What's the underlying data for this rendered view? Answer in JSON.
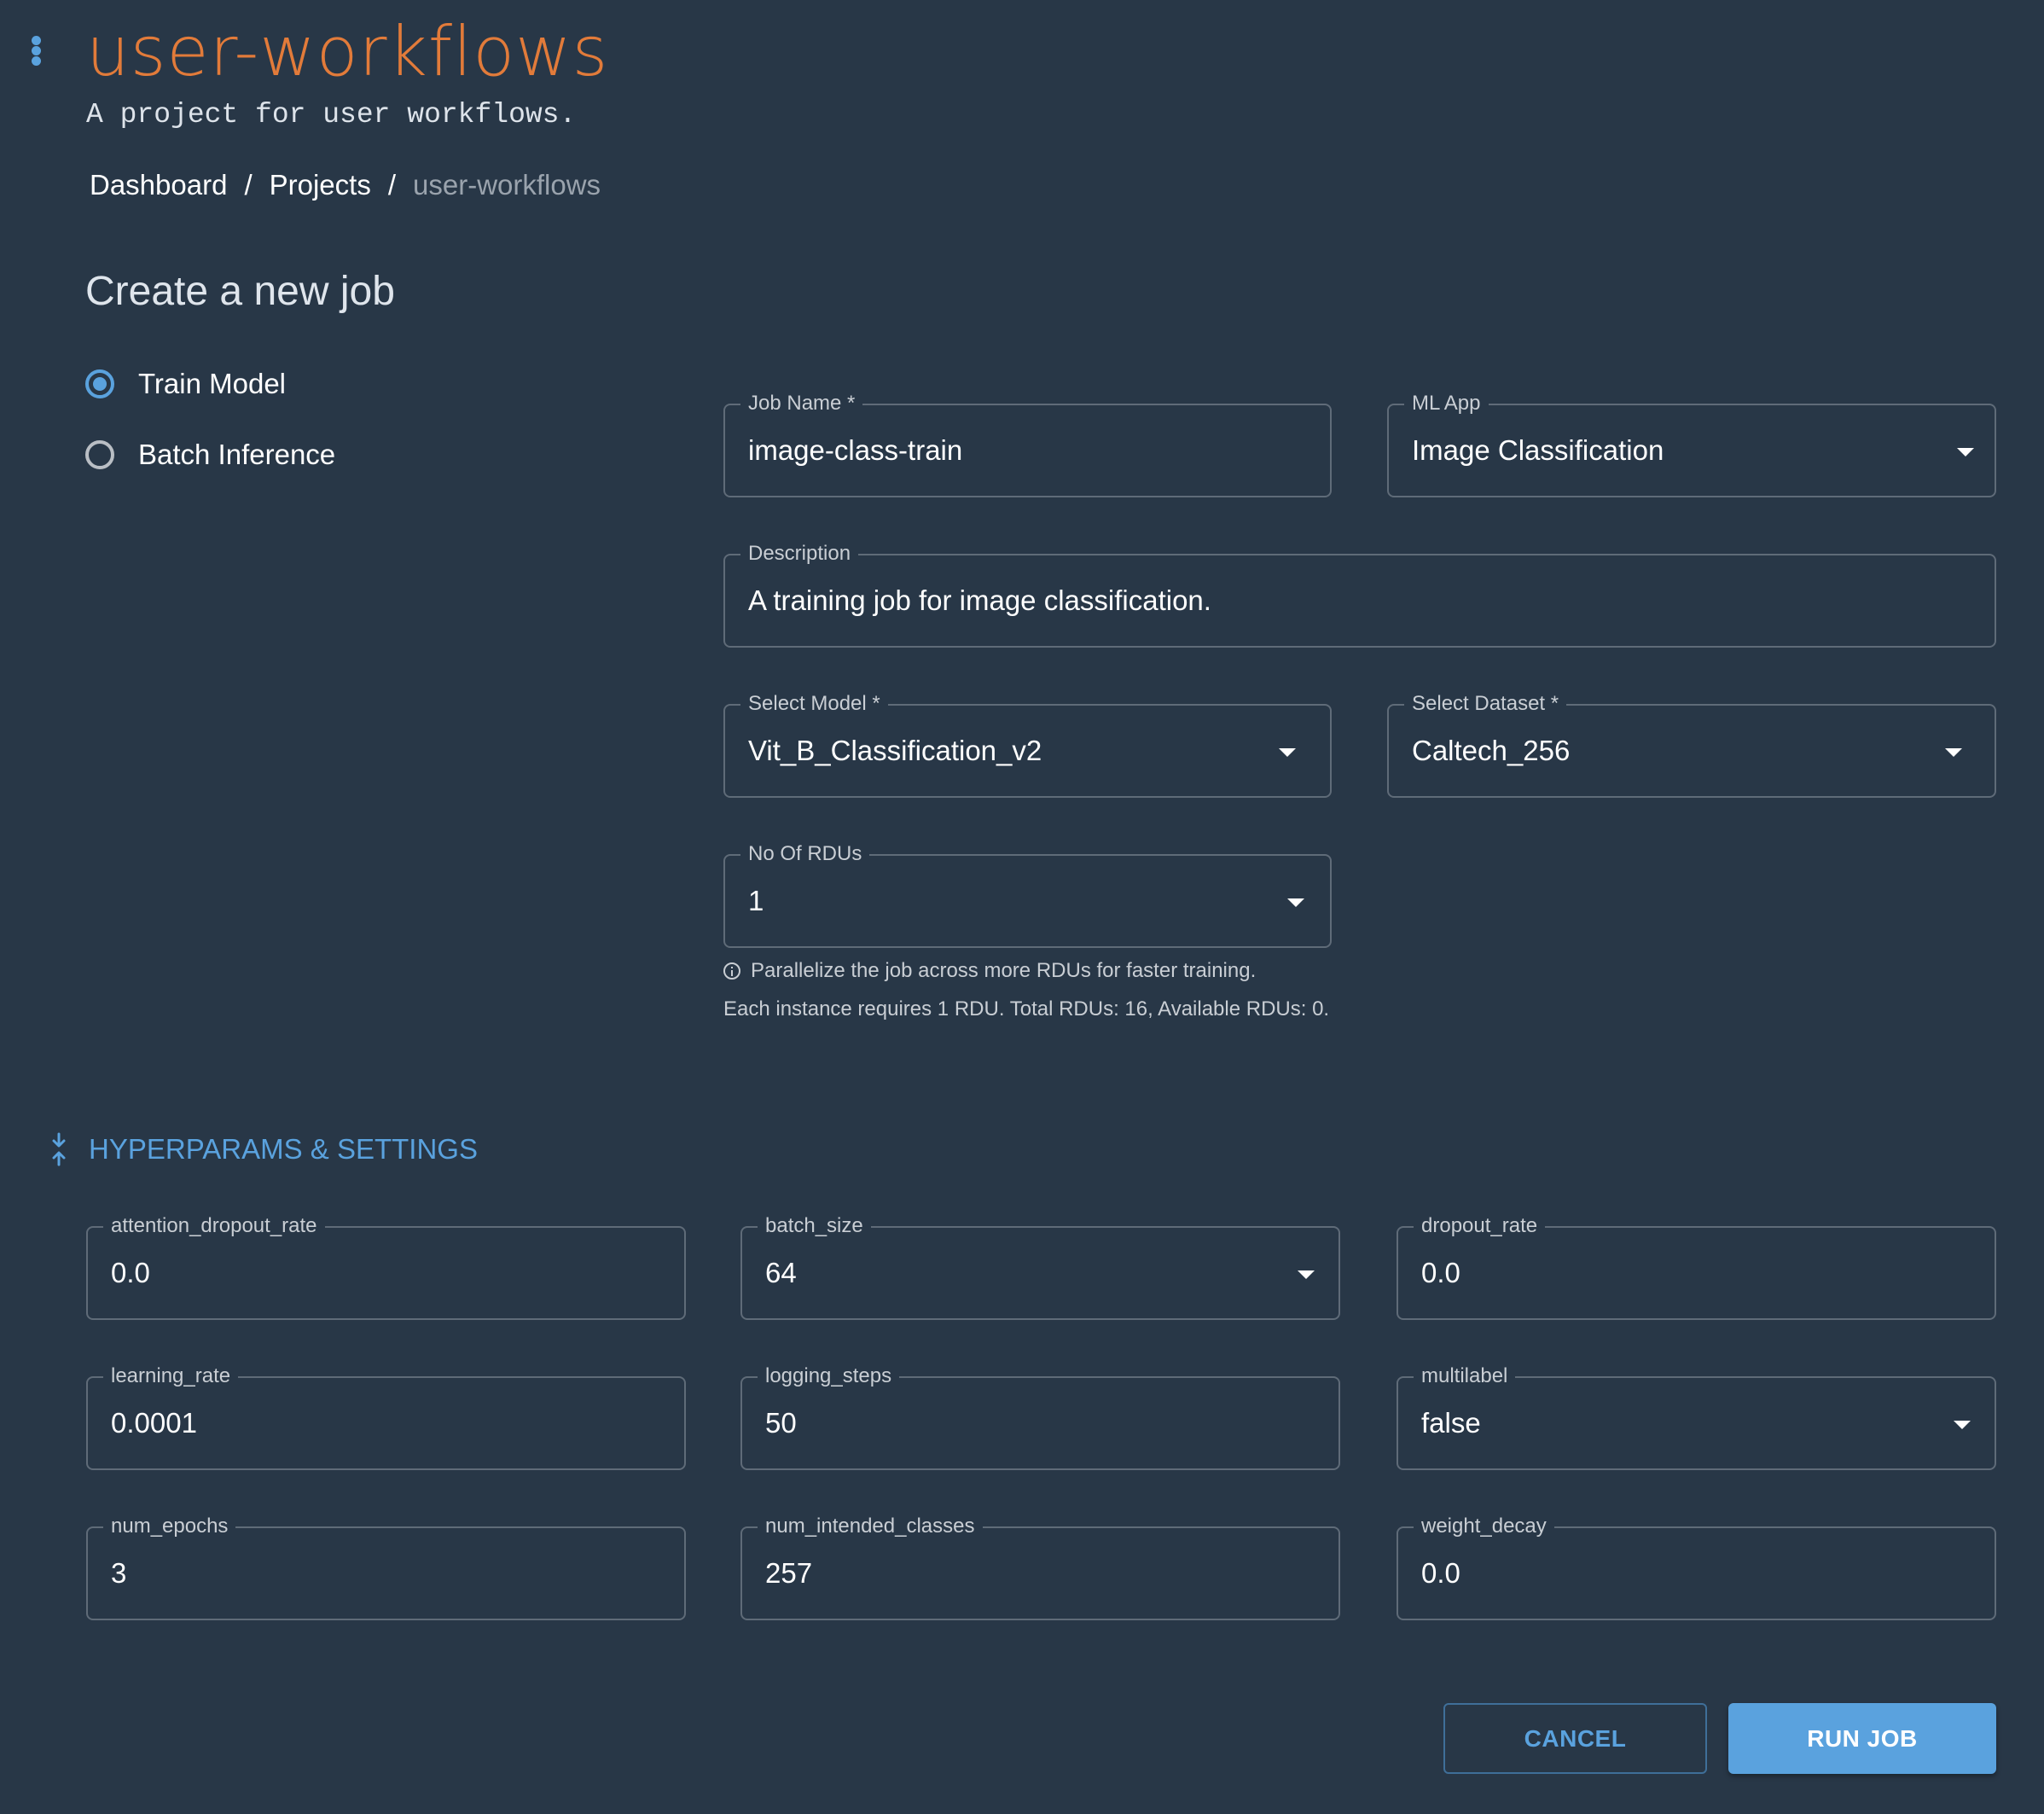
{
  "header": {
    "menu_icon": "kebab-vertical-icon",
    "title": "user-workflows",
    "subtitle": "A project for user workflows.",
    "title_color": "#e27b3a"
  },
  "breadcrumb": {
    "items": [
      "Dashboard",
      "Projects"
    ],
    "current": "user-workflows",
    "separator": "/"
  },
  "page": {
    "title": "Create a new job"
  },
  "job_type": {
    "options": [
      {
        "label": "Train Model",
        "selected": true
      },
      {
        "label": "Batch Inference",
        "selected": false
      }
    ]
  },
  "form": {
    "job_name": {
      "label": "Job Name *",
      "value": "image-class-train"
    },
    "ml_app": {
      "label": "ML App",
      "value": "Image Classification"
    },
    "description": {
      "label": "Description",
      "value": "A training job for image classification."
    },
    "model": {
      "label": "Select Model *",
      "value": "Vit_B_Classification_v2"
    },
    "dataset": {
      "label": "Select Dataset *",
      "value": "Caltech_256"
    },
    "rdus": {
      "label": "No Of RDUs",
      "value": "1",
      "info": "Parallelize the job across more RDUs for faster training.",
      "detail": "Each instance requires 1 RDU. Total RDUs: 16, Available RDUs: 0."
    }
  },
  "hyperparams": {
    "section_title": "HYPERPARAMS & SETTINGS",
    "section_icon": "collapse-vertical-icon",
    "fields": [
      {
        "label": "attention_dropout_rate",
        "value": "0.0",
        "type": "text"
      },
      {
        "label": "batch_size",
        "value": "64",
        "type": "select"
      },
      {
        "label": "dropout_rate",
        "value": "0.0",
        "type": "text"
      },
      {
        "label": "learning_rate",
        "value": "0.0001",
        "type": "text"
      },
      {
        "label": "logging_steps",
        "value": "50",
        "type": "text"
      },
      {
        "label": "multilabel",
        "value": "false",
        "type": "select"
      },
      {
        "label": "num_epochs",
        "value": "3",
        "type": "text"
      },
      {
        "label": "num_intended_classes",
        "value": "257",
        "type": "text"
      },
      {
        "label": "weight_decay",
        "value": "0.0",
        "type": "text"
      }
    ]
  },
  "actions": {
    "cancel_label": "CANCEL",
    "run_label": "RUN JOB",
    "accent_color": "#5aa2de"
  }
}
